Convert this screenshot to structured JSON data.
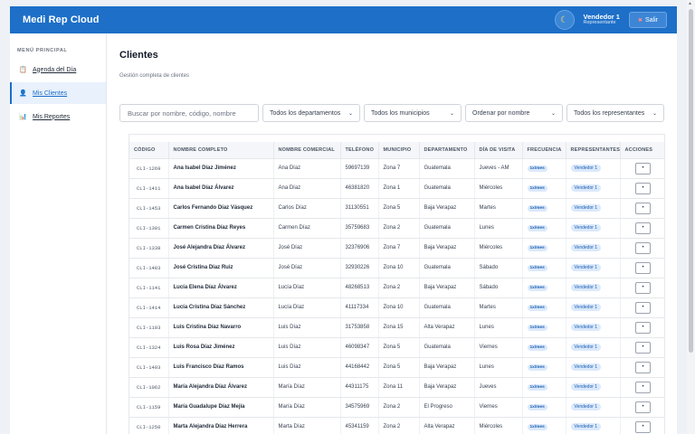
{
  "app": {
    "title": "Medi Rep Cloud"
  },
  "user": {
    "name": "Vendedor 1",
    "role": "Representante",
    "logout_label": "Salir",
    "theme_icon": "moon-icon"
  },
  "sidebar": {
    "section_title": "MENÚ PRINCIPAL",
    "items": [
      {
        "label": "Agenda del Día",
        "icon": "clipboard-icon",
        "active": false
      },
      {
        "label": "Mis Clientes",
        "icon": "person-icon",
        "active": true
      },
      {
        "label": "Mis Reportes",
        "icon": "bar-chart-icon",
        "active": false
      }
    ]
  },
  "main": {
    "title": "Clientes",
    "subtitle": "Gestión completa de clientes",
    "search": {
      "placeholder": "Buscar por nombre, código, nombre"
    },
    "filters": [
      {
        "value": "Todos los departamentos"
      },
      {
        "value": "Todos los municipios"
      },
      {
        "value": "Ordenar por nombre"
      },
      {
        "value": "Todos los representantes"
      }
    ]
  },
  "table": {
    "headers": [
      "CÓDIGO",
      "NOMBRE COMPLETO",
      "NOMBRE COMERCIAL",
      "TELÉFONO",
      "MUNICIPIO",
      "DEPARTAMENTO",
      "DÍA DE VISITA",
      "FRECUENCIA",
      "REPRESENTANTES",
      "ACCIONES"
    ],
    "rows": [
      [
        "CLI-1269",
        "Ana Isabel Díaz Jiménez",
        "Ana Díaz",
        "59697139",
        "Zona 7",
        "Guatemala",
        "Jueves - AM",
        "1x/mes",
        "Vendedor 1"
      ],
      [
        "CLI-1411",
        "Ana Isabel Díaz Álvarez",
        "Ana Díaz",
        "46381820",
        "Zona 1",
        "Guatemala",
        "Miércoles",
        "1x/mes",
        "Vendedor 1"
      ],
      [
        "CLI-1453",
        "Carlos Fernando Díaz Vásquez",
        "Carlos Díaz",
        "31130551",
        "Zona 5",
        "Baja Verapaz",
        "Martes",
        "1x/mes",
        "Vendedor 1"
      ],
      [
        "CLI-1301",
        "Carmen Cristina Díaz Reyes",
        "Carmen Díaz",
        "35759683",
        "Zona 2",
        "Guatemala",
        "Lunes",
        "1x/mes",
        "Vendedor 1"
      ],
      [
        "CLI-1338",
        "José Alejandra Díaz Álvarez",
        "José Díaz",
        "32376906",
        "Zona 7",
        "Baja Verapaz",
        "Miércoles",
        "1x/mes",
        "Vendedor 1"
      ],
      [
        "CLI-1483",
        "José Cristina Díaz Ruiz",
        "José Díaz",
        "32930226",
        "Zona 10",
        "Guatemala",
        "Sábado",
        "1x/mes",
        "Vendedor 1"
      ],
      [
        "CLI-1141",
        "Lucía Elena Díaz Álvarez",
        "Lucía Díaz",
        "48268513",
        "Zona 2",
        "Baja Verapaz",
        "Sábado",
        "1x/mes",
        "Vendedor 1"
      ],
      [
        "CLI-1414",
        "Lucía Cristina Díaz Sánchez",
        "Lucía Díaz",
        "41117334",
        "Zona 10",
        "Guatemala",
        "Martes",
        "1x/mes",
        "Vendedor 1"
      ],
      [
        "CLI-1103",
        "Luis Cristina Díaz Navarro",
        "Luis Díaz",
        "31753858",
        "Zona 15",
        "Alta Verapaz",
        "Lunes",
        "1x/mes",
        "Vendedor 1"
      ],
      [
        "CLI-1324",
        "Luis Rosa Díaz Jiménez",
        "Luis Díaz",
        "46098347",
        "Zona 5",
        "Guatemala",
        "Viernes",
        "1x/mes",
        "Vendedor 1"
      ],
      [
        "CLI-1403",
        "Luis Francisco Díaz Ramos",
        "Luis Díaz",
        "44168442",
        "Zona 5",
        "Baja Verapaz",
        "Lunes",
        "1x/mes",
        "Vendedor 1"
      ],
      [
        "CLI-1062",
        "María Alejandra Díaz Álvarez",
        "María Díaz",
        "44311175",
        "Zona 11",
        "Baja Verapaz",
        "Jueves",
        "1x/mes",
        "Vendedor 1"
      ],
      [
        "CLI-1159",
        "María Guadalupe Díaz Mejía",
        "María Díaz",
        "34575969",
        "Zona 2",
        "El Progreso",
        "Viernes",
        "1x/mes",
        "Vendedor 1"
      ],
      [
        "CLI-1250",
        "Marta Alejandra Díaz Herrera",
        "Marta Díaz",
        "45341159",
        "Zona 2",
        "Alta Verapaz",
        "Miércoles",
        "1x/mes",
        "Vendedor 1"
      ]
    ],
    "action_icon": "eye-icon"
  }
}
